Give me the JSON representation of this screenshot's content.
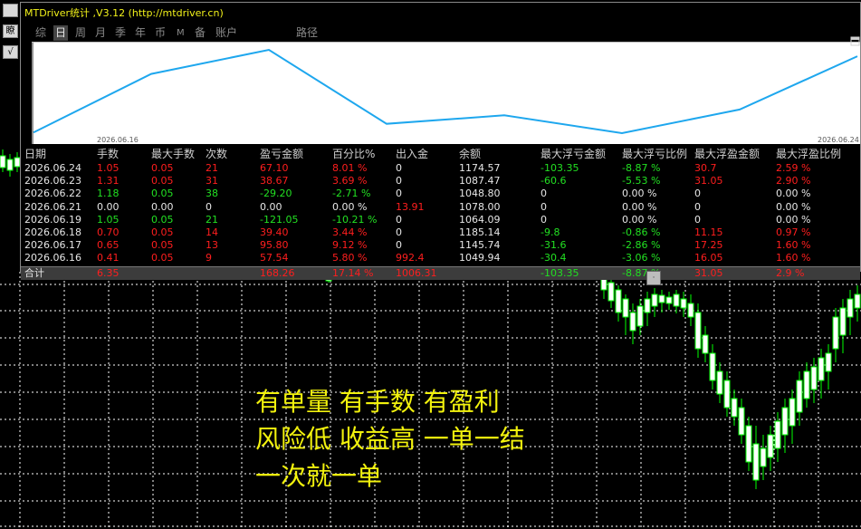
{
  "panel": {
    "title": "MTDriver统计 ,V3.12 (http://mtdriver.cn)",
    "tabs": [
      {
        "label": "综"
      },
      {
        "label": "日",
        "active": true
      },
      {
        "label": "周"
      },
      {
        "label": "月"
      },
      {
        "label": "季"
      },
      {
        "label": "年"
      },
      {
        "label": "币"
      },
      {
        "label": "M"
      },
      {
        "label": "备"
      },
      {
        "label": "账户"
      },
      {
        "label": "路径"
      }
    ]
  },
  "equity_curve": {
    "start_label": "2026.06.16",
    "end_label": "2026.06.24",
    "line_color": "#1ea7ee",
    "balance_points": [
      1049.94,
      1145.74,
      1185.14,
      1064.09,
      1078.0,
      1048.8,
      1087.47,
      1174.57
    ]
  },
  "table": {
    "headers": [
      "日期",
      "手数",
      "最大手数",
      "次数",
      "盈亏金额",
      "百分比%",
      "出入金",
      "余额",
      "最大浮亏金额",
      "最大浮亏比例",
      "最大浮盈金额",
      "最大浮盈比例"
    ],
    "rows": [
      {
        "date": "2026.06.24",
        "lots": "1.05",
        "max_lots": "0.05",
        "count": "21",
        "pnl": "67.10",
        "pct": "8.01 %",
        "cash": "0",
        "balance": "1174.57",
        "max_float_loss": "-103.35",
        "max_float_loss_pct": "-8.87 %",
        "max_float_profit": "30.7",
        "max_float_profit_pct": "2.59 %",
        "color": "r"
      },
      {
        "date": "2026.06.23",
        "lots": "1.31",
        "max_lots": "0.05",
        "count": "31",
        "pnl": "38.67",
        "pct": "3.69 %",
        "cash": "0",
        "balance": "1087.47",
        "max_float_loss": "-60.6",
        "max_float_loss_pct": "-5.53 %",
        "max_float_profit": "31.05",
        "max_float_profit_pct": "2.90 %",
        "color": "r"
      },
      {
        "date": "2026.06.22",
        "lots": "1.18",
        "max_lots": "0.05",
        "count": "38",
        "pnl": "-29.20",
        "pct": "-2.71 %",
        "cash": "0",
        "balance": "1048.80",
        "max_float_loss": "0",
        "max_float_loss_pct": "0.00 %",
        "max_float_profit": "0",
        "max_float_profit_pct": "0.00 %",
        "color": "g"
      },
      {
        "date": "2026.06.21",
        "lots": "0.00",
        "max_lots": "0.00",
        "count": "0",
        "pnl": "0.00",
        "pct": "0.00 %",
        "cash": "13.91",
        "balance": "1078.00",
        "max_float_loss": "0",
        "max_float_loss_pct": "0.00 %",
        "max_float_profit": "0",
        "max_float_profit_pct": "0.00 %",
        "color": "w"
      },
      {
        "date": "2026.06.19",
        "lots": "1.05",
        "max_lots": "0.05",
        "count": "21",
        "pnl": "-121.05",
        "pct": "-10.21 %",
        "cash": "0",
        "balance": "1064.09",
        "max_float_loss": "0",
        "max_float_loss_pct": "0.00 %",
        "max_float_profit": "0",
        "max_float_profit_pct": "0.00 %",
        "color": "g"
      },
      {
        "date": "2026.06.18",
        "lots": "0.70",
        "max_lots": "0.05",
        "count": "14",
        "pnl": "39.40",
        "pct": "3.44 %",
        "cash": "0",
        "balance": "1185.14",
        "max_float_loss": "-9.8",
        "max_float_loss_pct": "-0.86 %",
        "max_float_profit": "11.15",
        "max_float_profit_pct": "0.97 %",
        "color": "r"
      },
      {
        "date": "2026.06.17",
        "lots": "0.65",
        "max_lots": "0.05",
        "count": "13",
        "pnl": "95.80",
        "pct": "9.12 %",
        "cash": "0",
        "balance": "1145.74",
        "max_float_loss": "-31.6",
        "max_float_loss_pct": "-2.86 %",
        "max_float_profit": "17.25",
        "max_float_profit_pct": "1.60 %",
        "color": "r"
      },
      {
        "date": "2026.06.16",
        "lots": "0.41",
        "max_lots": "0.05",
        "count": "9",
        "pnl": "57.54",
        "pct": "5.80 %",
        "cash": "992.4",
        "balance": "1049.94",
        "max_float_loss": "-30.4",
        "max_float_loss_pct": "-3.06 %",
        "max_float_profit": "16.05",
        "max_float_profit_pct": "1.60 %",
        "color": "r"
      }
    ],
    "total": {
      "label": "合计",
      "lots": "6.35",
      "pnl": "168.26",
      "pct": "17.14 %",
      "cash": "1006.31",
      "max_float_loss": "-103.35",
      "max_float_loss_pct": "-8.87 %",
      "max_float_profit": "31.05",
      "max_float_profit_pct": "2.9 %"
    }
  },
  "overlay_text": {
    "line1": "有单量 有手数 有盈利",
    "line2": "风险低 收益高 一单一结",
    "line3": "一次就一单"
  },
  "side_buttons": {
    "top": "",
    "mid": "瞭",
    "bot": "√"
  },
  "colors": {
    "bull_candle": "#00ff00",
    "grid": "#ffffff",
    "title": "#f2f21a"
  }
}
